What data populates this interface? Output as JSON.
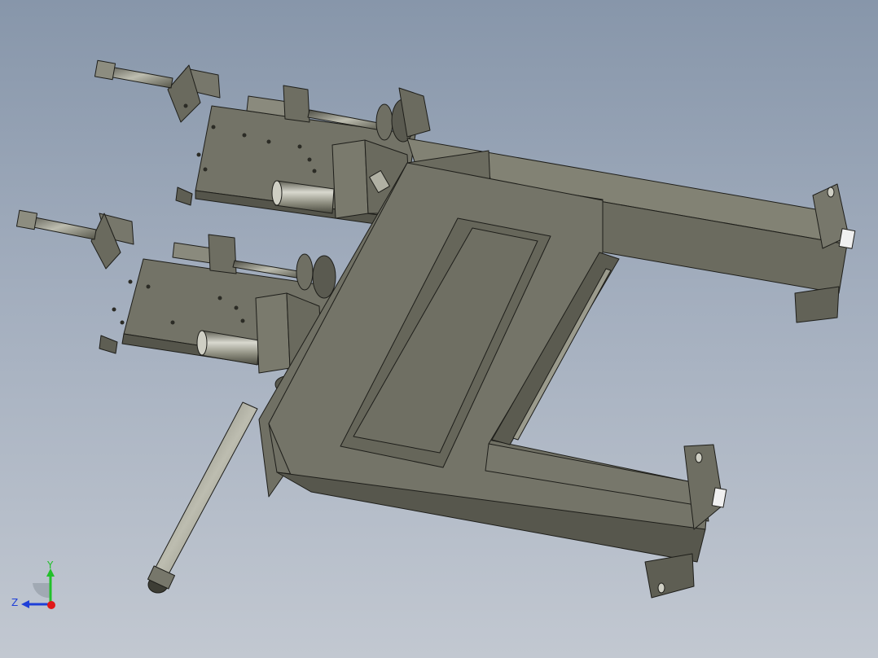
{
  "viewport": {
    "background_top": "#8796aa",
    "background_bottom": "#c2c8d1",
    "model_color": "#6b6b5f",
    "model_dark": "#4f4f45",
    "model_light": "#828274",
    "edge_color": "#1e1e1a"
  },
  "triad": {
    "y_label": "Y",
    "z_label": "Z",
    "y_color": "#22c02a",
    "z_color": "#1f3fd8",
    "x_color": "#e01818",
    "icons": [
      "y-axis-arrow-icon",
      "z-axis-arrow-icon",
      "x-axis-dot-icon"
    ]
  }
}
